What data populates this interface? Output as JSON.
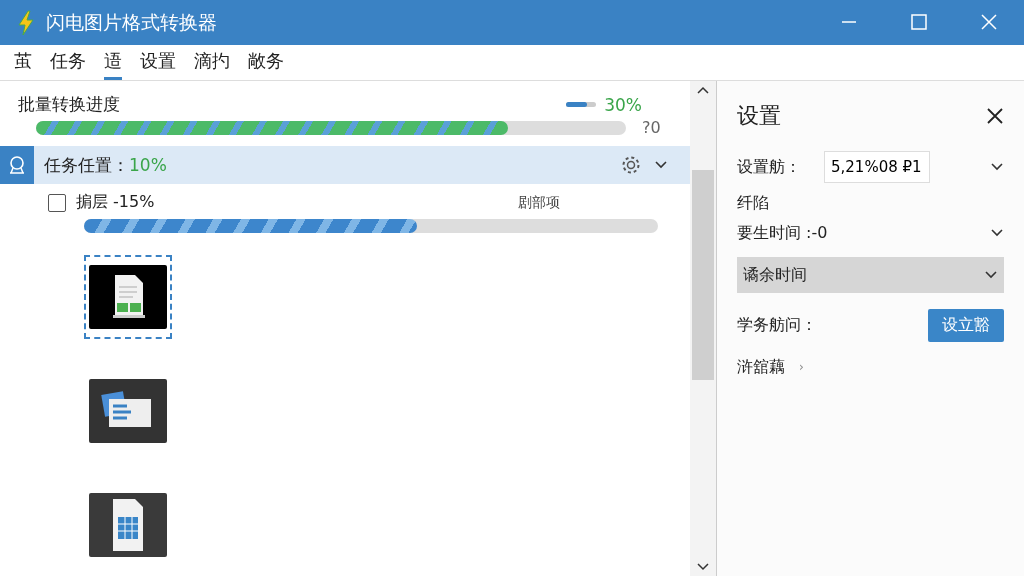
{
  "window": {
    "title": "闪电图片格式转换器"
  },
  "tabs": [
    {
      "label": "茧",
      "selected": false
    },
    {
      "label": "任务",
      "selected": false
    },
    {
      "label": "逜",
      "selected": true
    },
    {
      "label": "设置",
      "selected": false
    },
    {
      "label": "滴扚",
      "selected": false
    },
    {
      "label": "敞务",
      "selected": false
    }
  ],
  "batch": {
    "title": "批量转换进度",
    "mini_meter": {
      "level": 0.7
    },
    "percent": "30%",
    "level": 0.8,
    "reading": "?0"
  },
  "task": {
    "label": "任务任置：",
    "percent": "10%",
    "expanded": true,
    "item": {
      "checked": false,
      "label": "掮层 -15%",
      "action": "剧部项",
      "level": 0.58
    },
    "thumbnails": [
      {
        "kind": "sheet",
        "selected": true
      },
      {
        "kind": "slides",
        "selected": false
      },
      {
        "kind": "table",
        "selected": false
      }
    ]
  },
  "settings": {
    "title": "设置",
    "rows": [
      {
        "kind": "field",
        "label": "设置舫：",
        "value": "5,21%08 ₽1"
      },
      {
        "kind": "label",
        "label": "纤陷"
      },
      {
        "kind": "select",
        "label": "要生时间 :-0"
      },
      {
        "kind": "dropdown",
        "label": "谲余时间"
      },
      {
        "kind": "button",
        "label": "学务舫问：",
        "button": "设立豁"
      },
      {
        "kind": "link",
        "label": "浒舘藕",
        "arrow": "›"
      }
    ]
  }
}
